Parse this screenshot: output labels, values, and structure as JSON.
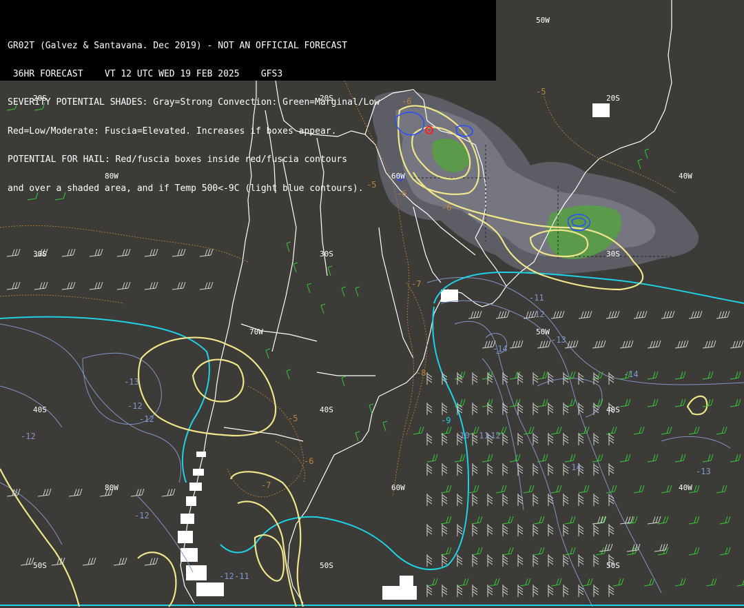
{
  "header": {
    "lines": [
      "GR02T (Galvez & Santavana. Dec 2019) - NOT AN OFFICIAL FORECAST",
      " 36HR FORECAST    VT 12 UTC WED 19 FEB 2025    GFS3",
      "SEVERITY POTENTIAL SHADES: Gray=Strong Convection: Green=Marginal/Low",
      "Red=Low/Moderate: Fuscia=Elevated. Increases if boxes appear.",
      "POTENTIAL FOR HAIL: Red/fuscia boxes inside red/fuscia contours",
      "and over a shaded area, and if Temp 500<-9C (light blue contours)."
    ]
  },
  "grid_labels": [
    {
      "id": "lat-20s-w",
      "text": "20S"
    },
    {
      "id": "lat-20s-c",
      "text": "20S"
    },
    {
      "id": "lat-20s-e",
      "text": "20S"
    },
    {
      "id": "lon-50w-n",
      "text": "50W"
    },
    {
      "id": "lon-80w-n",
      "text": "80W"
    },
    {
      "id": "lon-60w-n",
      "text": "60W"
    },
    {
      "id": "lon-40w-n",
      "text": "40W"
    },
    {
      "id": "lat-30s-w",
      "text": "30S"
    },
    {
      "id": "lat-30s-c",
      "text": "30S"
    },
    {
      "id": "lat-30s-e",
      "text": "30S"
    },
    {
      "id": "lon-70w",
      "text": "70W"
    },
    {
      "id": "lon-50w-m",
      "text": "50W"
    },
    {
      "id": "lat-40s-w",
      "text": "40S"
    },
    {
      "id": "lat-40s-c",
      "text": "40S"
    },
    {
      "id": "lat-40s-e",
      "text": "40S"
    },
    {
      "id": "lon-80w-s",
      "text": "80W"
    },
    {
      "id": "lon-60w-s",
      "text": "60W"
    },
    {
      "id": "lon-40w-s",
      "text": "40W"
    },
    {
      "id": "lat-50s-w",
      "text": "50S"
    },
    {
      "id": "lat-50s-c",
      "text": "50S"
    },
    {
      "id": "lat-50s-e",
      "text": "50S"
    }
  ],
  "orange_contour_labels": [
    "-6",
    "-5",
    "-5",
    "-6",
    "-6",
    "-7",
    "-8",
    "-5",
    "-6",
    "-7"
  ],
  "blue_contour_labels": [
    "-11",
    "-12",
    "-13",
    "-14",
    "-14",
    "-13",
    "-12",
    "-12",
    "-12",
    "-12",
    "-9",
    "-10",
    "-11",
    "-12",
    "-14",
    "-13",
    "-12",
    "-11"
  ],
  "colors": {
    "background": "#3c3b37",
    "coastline": "#ffffff",
    "yellow_contour": "#f1e58a",
    "cyan_contour": "#1fd3e6",
    "steelblue_contour": "#7f97c9",
    "orange_contour": "#c0843a",
    "gray_shade": "#6b6b74",
    "green_shade": "#5a9a4a",
    "wind_green": "#33cc33",
    "wind_white": "#d8d8d8"
  }
}
